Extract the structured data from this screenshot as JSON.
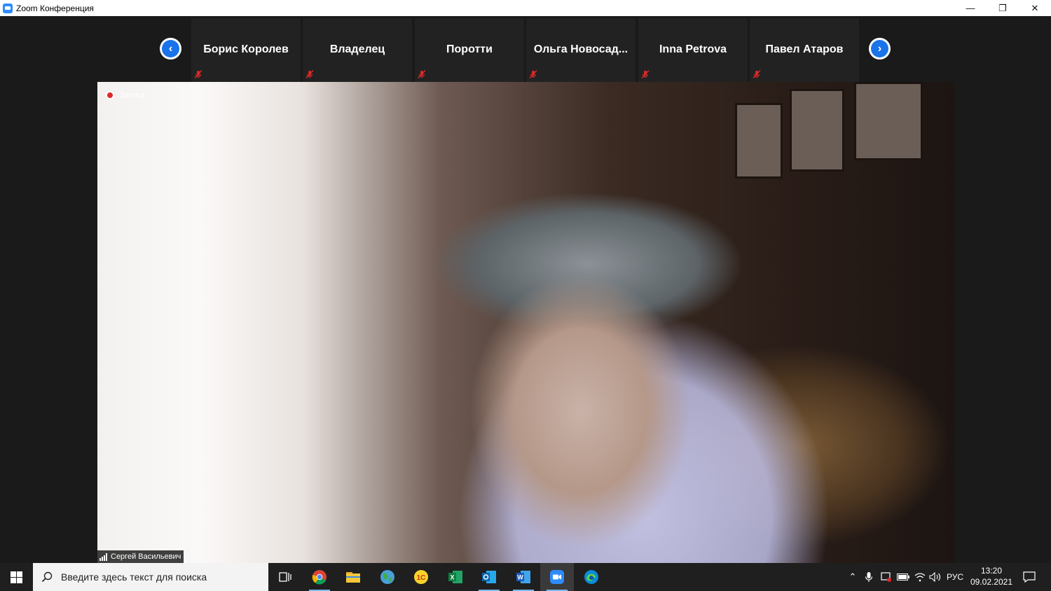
{
  "window": {
    "title": "Zoom Конференция",
    "controls": {
      "minimize": "—",
      "maximize": "❐",
      "close": "✕"
    }
  },
  "gallery": {
    "prev_icon": "chevron-left-icon",
    "next_icon": "chevron-right-icon",
    "participants": [
      {
        "name": "Борис Королев",
        "muted": true
      },
      {
        "name": "Владелец",
        "muted": true
      },
      {
        "name": "Поротти",
        "muted": true
      },
      {
        "name": "Ольга  Новосад...",
        "muted": true
      },
      {
        "name": "Inna Petrova",
        "muted": true
      },
      {
        "name": "Павел Атаров",
        "muted": true
      }
    ]
  },
  "active_speaker": {
    "recording_label": "Запись",
    "name": "Сергей Васильевич"
  },
  "taskbar": {
    "search_placeholder": "Введите здесь текст для поиска",
    "apps": [
      "task-view",
      "chrome",
      "file-explorer",
      "maps",
      "1c",
      "excel",
      "outlook",
      "word",
      "zoom",
      "edge"
    ],
    "language": "РУС",
    "time": "13:20",
    "date": "09.02.2021"
  },
  "colors": {
    "accent_blue": "#1a73e8",
    "recording_red": "#e02828",
    "mute_red": "#e02828",
    "background": "#1a1a1a"
  }
}
